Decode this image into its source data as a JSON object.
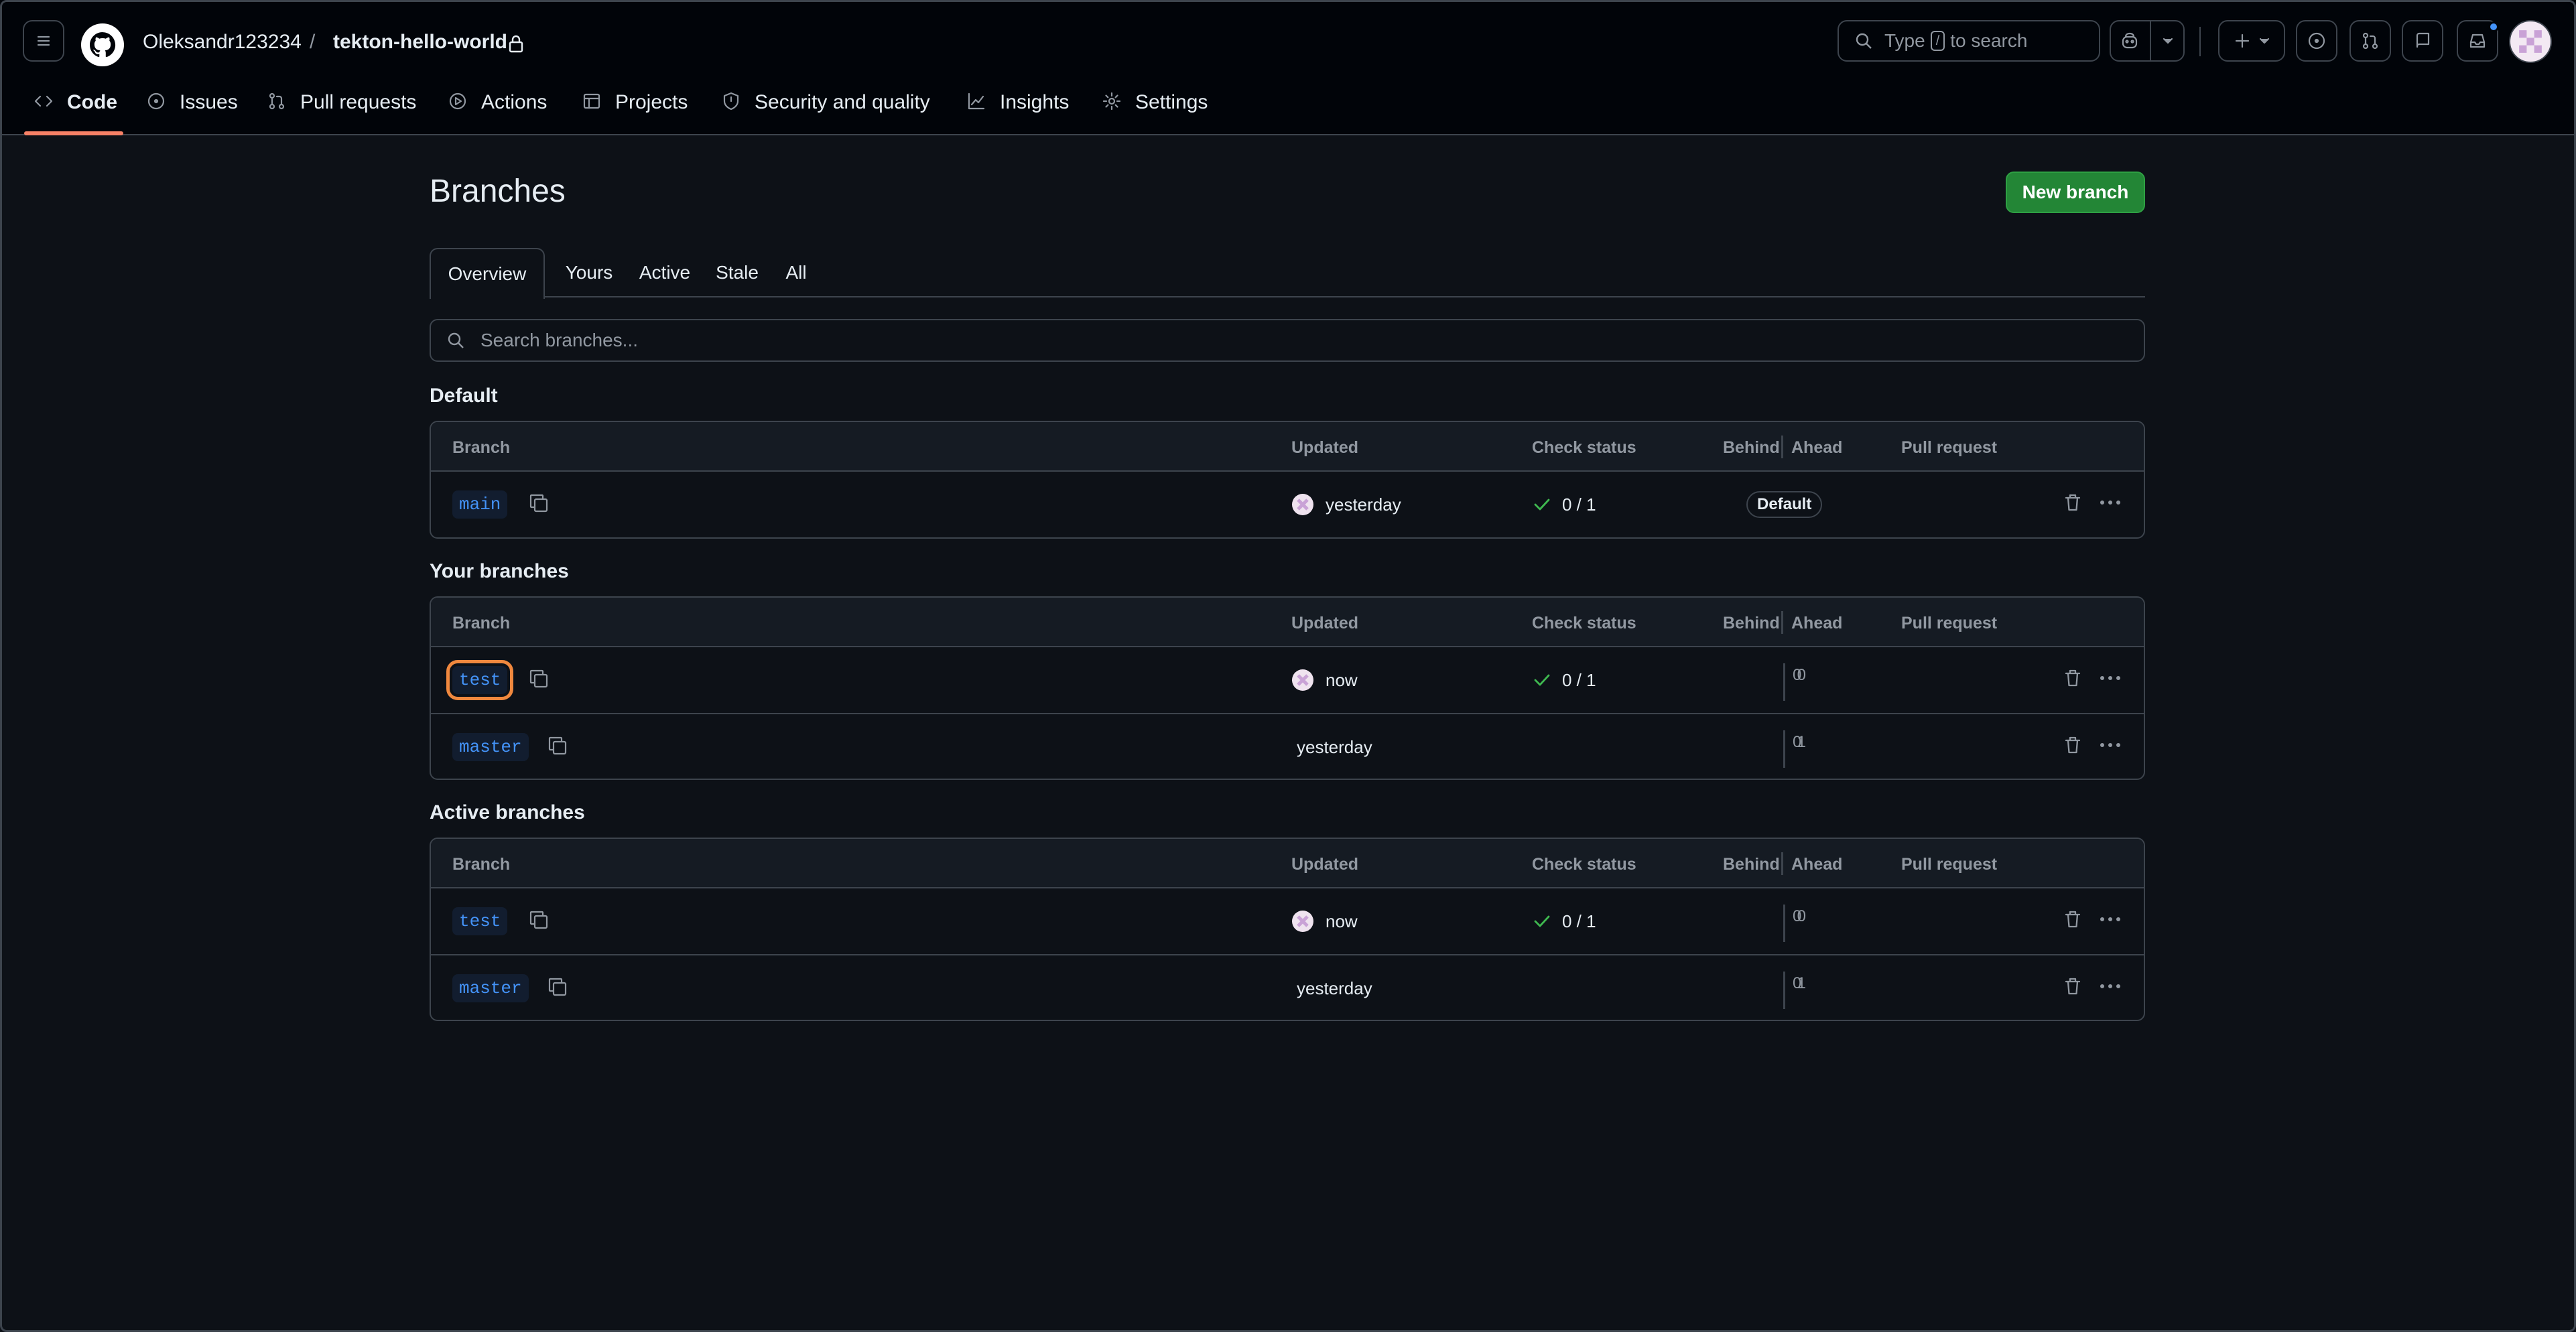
{
  "header": {
    "owner": "Oleksandr123234",
    "separator": "/",
    "repo": "tekton-hello-world",
    "search_prefix": "Type",
    "search_key": "/",
    "search_suffix": "to search"
  },
  "repo_nav": [
    {
      "label": "Code",
      "icon": "code-icon"
    },
    {
      "label": "Issues",
      "icon": "issue-icon"
    },
    {
      "label": "Pull requests",
      "icon": "pull-request-icon"
    },
    {
      "label": "Actions",
      "icon": "play-icon"
    },
    {
      "label": "Projects",
      "icon": "table-icon"
    },
    {
      "label": "Security and quality",
      "icon": "shield-icon"
    },
    {
      "label": "Insights",
      "icon": "graph-icon"
    },
    {
      "label": "Settings",
      "icon": "gear-icon"
    }
  ],
  "page": {
    "title": "Branches",
    "new_branch_label": "New branch",
    "search_placeholder": "Search branches..."
  },
  "subtabs": [
    "Overview",
    "Yours",
    "Active",
    "Stale",
    "All"
  ],
  "table_headers": {
    "branch": "Branch",
    "updated": "Updated",
    "check_status": "Check status",
    "behind": "Behind",
    "ahead": "Ahead",
    "pull_request": "Pull request"
  },
  "sections": {
    "default": {
      "title": "Default",
      "rows": [
        {
          "name": "main",
          "updated": "yesterday",
          "check": "0 / 1",
          "badge": "Default"
        }
      ]
    },
    "yours": {
      "title": "Your branches",
      "rows": [
        {
          "name": "test",
          "updated": "now",
          "check": "0 / 1",
          "behind": "0",
          "ahead": "0"
        },
        {
          "name": "master",
          "updated": "yesterday",
          "behind": "1",
          "ahead": "0"
        }
      ]
    },
    "active": {
      "title": "Active branches",
      "rows": [
        {
          "name": "test",
          "updated": "now",
          "check": "0 / 1",
          "behind": "0",
          "ahead": "0"
        },
        {
          "name": "master",
          "updated": "yesterday",
          "behind": "1",
          "ahead": "0"
        }
      ]
    }
  },
  "colors": {
    "background": "#0d1117",
    "header_bg": "#010409",
    "accent_underline": "#f78166",
    "primary_button": "#238636",
    "branch_link": "#4493f8",
    "check_success": "#3fb950",
    "highlight_box": "#f0883e"
  }
}
